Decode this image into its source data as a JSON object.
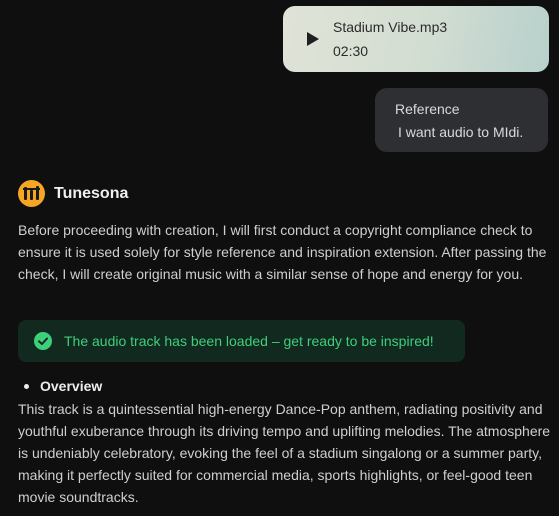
{
  "audio_card": {
    "file_name": "Stadium Vibe.mp3",
    "duration": "02:30",
    "play_icon": "play-icon"
  },
  "reference": {
    "title": "Reference",
    "message": "I want audio to MIdi."
  },
  "assistant": {
    "name": "Tunesona",
    "logo_icon": "tunesona-logo",
    "logo_color": "#f5a623",
    "intro": "Before proceeding with creation, I will first conduct a copyright compliance check to ensure it is used solely for style reference and inspiration extension. After passing the check, I will create original music with a similar sense of hope and energy for you."
  },
  "banner": {
    "text": "The audio track has been loaded – get ready to be inspired!",
    "icon": "check-circle-icon",
    "color": "#3ecf7b"
  },
  "overview": {
    "heading": "Overview",
    "body": "This track is a quintessential high-energy Dance-Pop anthem, radiating positivity and youthful exuberance through its driving tempo and uplifting melodies. The atmosphere is undeniably celebratory, evoking the feel of a stadium singalong or a summer party, making it perfectly suited for commercial media, sports highlights, or feel-good teen movie soundtracks."
  }
}
